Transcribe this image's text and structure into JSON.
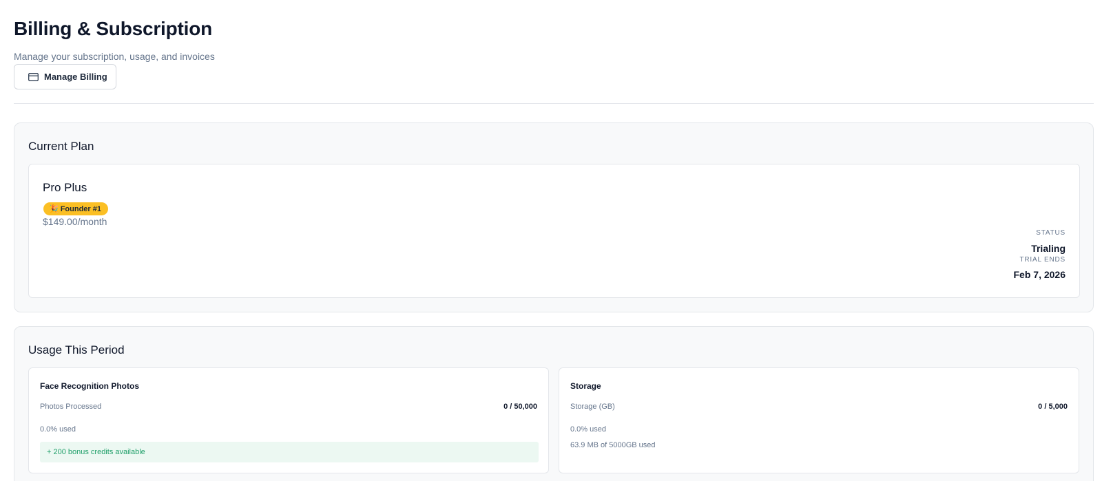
{
  "header": {
    "title": "Billing & Subscription",
    "subtitle": "Manage your subscription, usage, and invoices",
    "manage_billing_label": "Manage Billing",
    "manage_billing_icon": "credit-card-icon"
  },
  "current_plan": {
    "section_title": "Current Plan",
    "plan_name": "Pro Plus",
    "badge": {
      "emoji": "🎉",
      "label": "Founder #1",
      "color": "#fbbf24"
    },
    "price": "$149.00/month",
    "status_label": "STATUS",
    "status_value": "Trialing",
    "trial_ends_label": "TRIAL ENDS",
    "trial_ends_value": "Feb 7, 2026"
  },
  "usage": {
    "section_title": "Usage This Period",
    "face_recognition": {
      "title": "Face Recognition Photos",
      "metric_label": "Photos Processed",
      "metric_value": "0 / 50,000",
      "percent_used": "0.0% used",
      "bonus_text": "+ 200 bonus credits available",
      "bonus_color": "#22a06b"
    },
    "storage": {
      "title": "Storage",
      "metric_label": "Storage (GB)",
      "metric_value": "0 / 5,000",
      "percent_used": "0.0% used",
      "detail": "63.9 MB of 5000GB used"
    }
  }
}
